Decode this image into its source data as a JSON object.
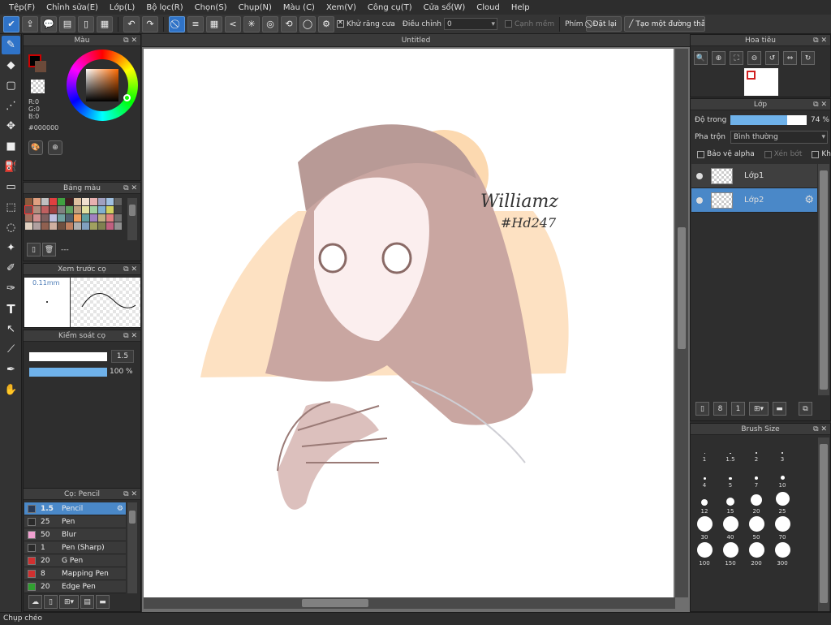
{
  "menu": [
    "Tệp(F)",
    "Chỉnh sửa(E)",
    "Lớp(L)",
    "Bộ lọc(R)",
    "Chọn(S)",
    "Chụp(N)",
    "Màu (C)",
    "Xem(V)",
    "Công cụ(T)",
    "Cửa sổ(W)",
    "Cloud",
    "Help"
  ],
  "toolbar": {
    "antialias": "Khử răng cưa",
    "correction_label": "Điều chỉnh",
    "correction_value": "0",
    "soft_edge": "Cạnh mềm",
    "key_label": "Phím",
    "reset": "Đặt lại",
    "make_line": "Tạo một đường thẳng"
  },
  "color_panel": {
    "title": "Màu",
    "r": "R:0",
    "g": "G:0",
    "b": "B:0",
    "hex": "#000000",
    "fg": "#000000"
  },
  "palette_panel": {
    "title": "Bảng màu",
    "dash": "---"
  },
  "brush_preview": {
    "title": "Xem trước cọ",
    "size": "0.11mm"
  },
  "brush_control": {
    "title": "Kiểm soát cọ",
    "size": "1.5",
    "opacity": "100 %",
    "opacity_value": 100
  },
  "brush_panel": {
    "title": "Cọ: Pencil",
    "items": [
      {
        "size": "1.5",
        "name": "Pencil",
        "color": "#2a3a55"
      },
      {
        "size": "25",
        "name": "Pen",
        "color": "#2a2a2a"
      },
      {
        "size": "50",
        "name": "Blur",
        "color": "#f0a0d0"
      },
      {
        "size": "1",
        "name": "Pen (Sharp)",
        "color": "#2a2a2a"
      },
      {
        "size": "20",
        "name": "G Pen",
        "color": "#d03030"
      },
      {
        "size": "8",
        "name": "Mapping Pen",
        "color": "#d03030"
      },
      {
        "size": "20",
        "name": "Edge Pen",
        "color": "#30a030"
      }
    ]
  },
  "document": {
    "title": "Untitled",
    "signature_line1": "Williamz",
    "signature_line2": "#Hd247"
  },
  "navigator": {
    "title": "Hoa tiêu"
  },
  "layer_panel": {
    "title": "Lớp",
    "opacity_label": "Độ trong",
    "opacity_value": "74 %",
    "opacity_num": 74,
    "blend_label": "Pha trộn",
    "blend_value": "Bình thường",
    "protect_alpha": "Bảo vệ alpha",
    "clip": "Xén bớt",
    "lock": "Khóa",
    "layers": [
      {
        "name": "Lớp1"
      },
      {
        "name": "Lớp2"
      }
    ]
  },
  "brush_size": {
    "title": "Brush Size",
    "sizes": [
      {
        "label": "1",
        "d": 1
      },
      {
        "label": "1.5",
        "d": 1.5
      },
      {
        "label": "2",
        "d": 2
      },
      {
        "label": "3",
        "d": 2.5
      },
      {
        "label": "4",
        "d": 3
      },
      {
        "label": "5",
        "d": 3.5
      },
      {
        "label": "7",
        "d": 4
      },
      {
        "label": "10",
        "d": 5
      },
      {
        "label": "12",
        "d": 8
      },
      {
        "label": "15",
        "d": 10
      },
      {
        "label": "20",
        "d": 14
      },
      {
        "label": "25",
        "d": 17
      },
      {
        "label": "30",
        "d": 19
      },
      {
        "label": "40",
        "d": 19
      },
      {
        "label": "50",
        "d": 19
      },
      {
        "label": "70",
        "d": 19
      },
      {
        "label": "100",
        "d": 19
      },
      {
        "label": "150",
        "d": 19
      },
      {
        "label": "200",
        "d": 19
      },
      {
        "label": "300",
        "d": 19
      }
    ]
  },
  "status": "Chụp chéo"
}
